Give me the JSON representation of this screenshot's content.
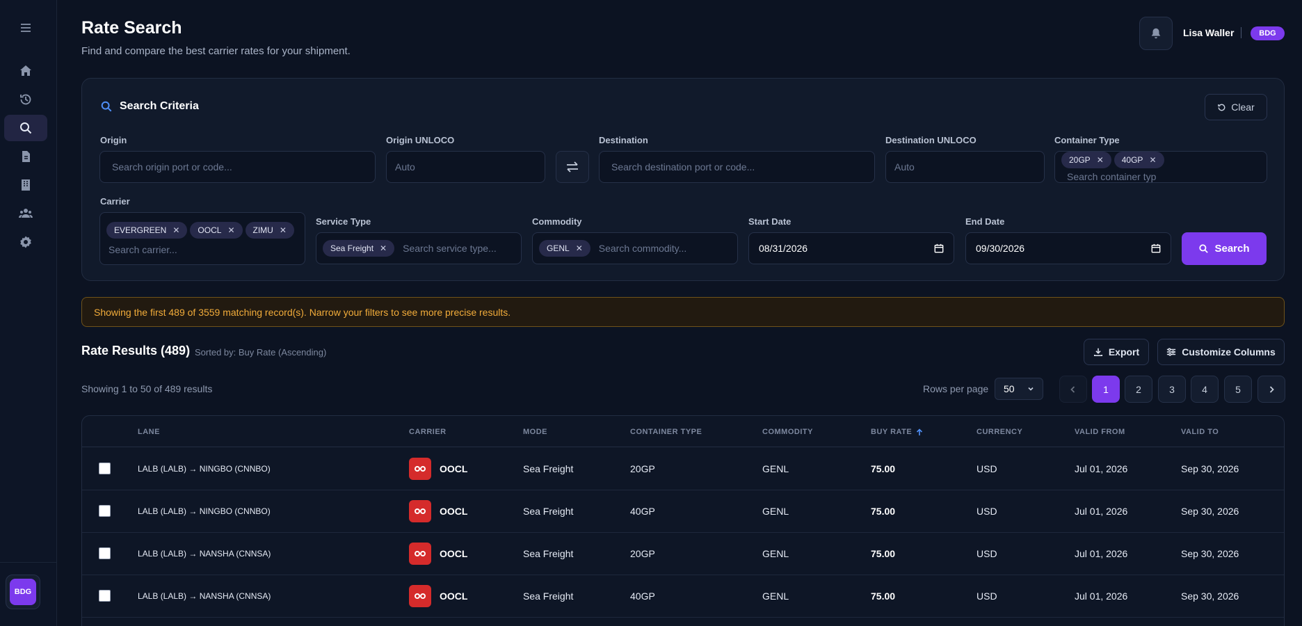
{
  "colors": {
    "accent": "#7c3aed",
    "background": "#0c1322",
    "warning": "#f2ac3a",
    "carrier_logo": "#d52b2b"
  },
  "sidebar": {
    "items": [
      {
        "icon": "menu-icon"
      },
      {
        "icon": "home-icon"
      },
      {
        "icon": "history-icon"
      },
      {
        "icon": "search-icon",
        "active": true
      },
      {
        "icon": "document-icon"
      },
      {
        "icon": "building-icon"
      },
      {
        "icon": "users-icon"
      },
      {
        "icon": "gear-icon"
      }
    ],
    "logo_text": "BDG"
  },
  "header": {
    "title": "Rate Search",
    "subtitle": "Find and compare the best carrier rates for your shipment.",
    "user_name": "Lisa Waller",
    "user_badge": "BDG"
  },
  "search": {
    "title": "Search Criteria",
    "clear_label": "Clear",
    "origin": {
      "label": "Origin",
      "placeholder": "Search origin port or code..."
    },
    "origin_unloco": {
      "label": "Origin UNLOCO",
      "placeholder": "Auto"
    },
    "destination": {
      "label": "Destination",
      "placeholder": "Search destination port or code..."
    },
    "destination_unloco": {
      "label": "Destination UNLOCO",
      "placeholder": "Auto"
    },
    "container_type": {
      "label": "Container Type",
      "chips": [
        "20GP",
        "40GP"
      ],
      "placeholder": "Search container typ"
    },
    "carrier": {
      "label": "Carrier",
      "chips": [
        "EVERGREEN",
        "OOCL",
        "ZIMU"
      ],
      "placeholder": "Search carrier..."
    },
    "service_type": {
      "label": "Service Type",
      "chips": [
        "Sea Freight"
      ],
      "placeholder": "Search service type..."
    },
    "commodity": {
      "label": "Commodity",
      "chips": [
        "GENL"
      ],
      "placeholder": "Search commodity..."
    },
    "start_date": {
      "label": "Start Date",
      "value": "08/31/2026"
    },
    "end_date": {
      "label": "End Date",
      "value": "09/30/2026"
    },
    "search_label": "Search"
  },
  "warning": "Showing the first 489 of 3559 matching record(s). Narrow your filters to see more precise results.",
  "results": {
    "title": "Rate Results (489)",
    "sorted_by": "Sorted by: Buy Rate (Ascending)",
    "export_label": "Export",
    "customize_label": "Customize Columns",
    "showing": "Showing 1 to 50 of 489 results",
    "rows_per_page_label": "Rows per page",
    "rows_per_page": "50",
    "pages": [
      "1",
      "2",
      "3",
      "4",
      "5"
    ],
    "current_page": "1",
    "columns": [
      "LANE",
      "CARRIER",
      "MODE",
      "CONTAINER TYPE",
      "COMMODITY",
      "BUY RATE",
      "CURRENCY",
      "VALID FROM",
      "VALID TO"
    ],
    "rows": [
      {
        "lane": "LALB (LALB) → NINGBO (CNNBO)",
        "carrier": "OOCL",
        "mode": "Sea Freight",
        "container": "20GP",
        "commodity": "GENL",
        "rate": "75.00",
        "currency": "USD",
        "valid_from": "Jul 01, 2026",
        "valid_to": "Sep 30, 2026"
      },
      {
        "lane": "LALB (LALB) → NINGBO (CNNBO)",
        "carrier": "OOCL",
        "mode": "Sea Freight",
        "container": "40GP",
        "commodity": "GENL",
        "rate": "75.00",
        "currency": "USD",
        "valid_from": "Jul 01, 2026",
        "valid_to": "Sep 30, 2026"
      },
      {
        "lane": "LALB (LALB) → NANSHA (CNNSA)",
        "carrier": "OOCL",
        "mode": "Sea Freight",
        "container": "20GP",
        "commodity": "GENL",
        "rate": "75.00",
        "currency": "USD",
        "valid_from": "Jul 01, 2026",
        "valid_to": "Sep 30, 2026"
      },
      {
        "lane": "LALB (LALB) → NANSHA (CNNSA)",
        "carrier": "OOCL",
        "mode": "Sea Freight",
        "container": "40GP",
        "commodity": "GENL",
        "rate": "75.00",
        "currency": "USD",
        "valid_from": "Jul 01, 2026",
        "valid_to": "Sep 30, 2026"
      }
    ]
  }
}
